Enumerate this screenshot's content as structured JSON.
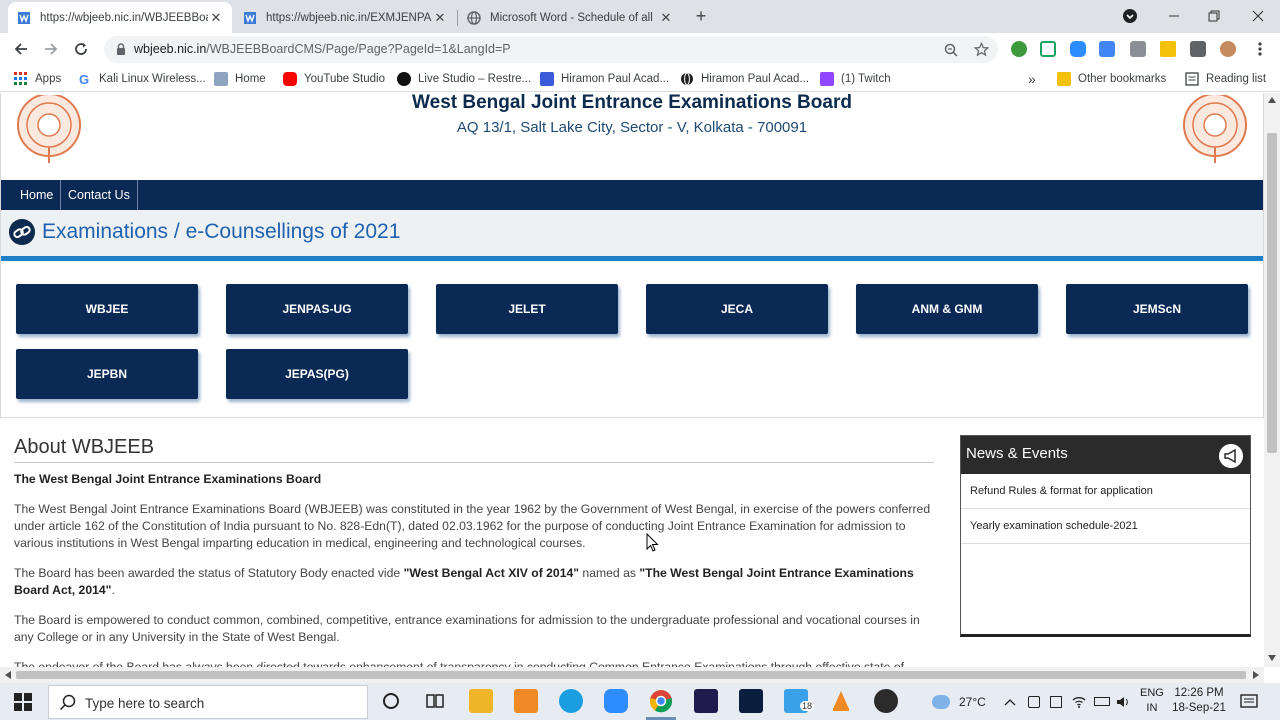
{
  "browser": {
    "tabs": [
      {
        "title": "https://wbjeeb.nic.in/WBJEEBBoa",
        "active": true
      },
      {
        "title": "https://wbjeeb.nic.in/EXMJENPAS",
        "active": false
      },
      {
        "title": "Microsoft Word - Schedule of all",
        "active": false
      }
    ],
    "close_glyph": "✕",
    "new_tab_glyph": "+",
    "url_host": "wbjeeb.nic.in",
    "url_path": "/WBJEEBBoardCMS/Page/Page?PageId=1&LangId=P",
    "bookmarks": [
      {
        "label": "Apps",
        "color": "#5f6368"
      },
      {
        "label": "Kali Linux Wireless...",
        "color": "#4285f4"
      },
      {
        "label": "Home",
        "color": "#7a8aa0"
      },
      {
        "label": "YouTube Studio",
        "color": "#ff0000"
      },
      {
        "label": "Live Studio – Restre...",
        "color": "#111111"
      },
      {
        "label": "Hiramon Paul Acad...",
        "color": "#3a5bd9"
      },
      {
        "label": "Hiramon Paul Acad...",
        "color": "#222222"
      },
      {
        "label": "(1) Twitch",
        "color": "#9146ff"
      }
    ],
    "bookmarks_more": "»",
    "other_bookmarks": "Other bookmarks",
    "reading_list": "Reading list"
  },
  "site": {
    "title": "West Bengal Joint Entrance Examinations Board",
    "address": "AQ 13/1, Salt Lake City, Sector - V, Kolkata - 700091",
    "nav": [
      "Home",
      "Contact Us"
    ],
    "exam_heading": "Examinations / e-Counsellings of 2021",
    "exams": [
      "WBJEE",
      "JENPAS-UG",
      "JELET",
      "JECA",
      "ANM & GNM",
      "JEMScN",
      "JEPBN",
      "JEPAS(PG)"
    ],
    "about": {
      "title": "About WBJEEB",
      "subtitle": "The West Bengal Joint Entrance Examinations Board",
      "p1": "The West Bengal Joint Entrance Examinations Board (WBJEEB) was constituted in the year 1962 by the Government of West Bengal, in exercise of the powers conferred under article 162 of the Constitution of India pursuant to No. 828-Edn(T), dated 02.03.1962 for the purpose of conducting Joint Entrance Examination for admission to various institutions in West Bengal imparting education in medical, engineering and technological courses.",
      "p2_a": "The Board has been awarded the status of Statutory Body enacted vide ",
      "p2_b": "\"West Bengal Act XIV of 2014\"",
      "p2_c": " named as ",
      "p2_d": "\"The West Bengal Joint Entrance Examinations Board Act, 2014\"",
      "p2_e": ".",
      "p3": "The Board is empowered to conduct common, combined, competitive, entrance examinations for admission to the undergraduate professional and vocational courses in any College or in any University in the State of West Bengal.",
      "p4": "The endeavor of the Board has always been directed towards enhancement of transparency in conducting Common Entrance Examinations through effective state of"
    },
    "news": {
      "title": "News & Events",
      "items": [
        "Refund Rules & format for application",
        "Yearly examination schedule-2021"
      ]
    }
  },
  "taskbar": {
    "search_placeholder": "Type here to search",
    "badge": "18",
    "temperature": "27°C",
    "lang1": "ENG",
    "lang2": "IN",
    "time": "12:26 PM",
    "date": "18-Sep-21"
  }
}
